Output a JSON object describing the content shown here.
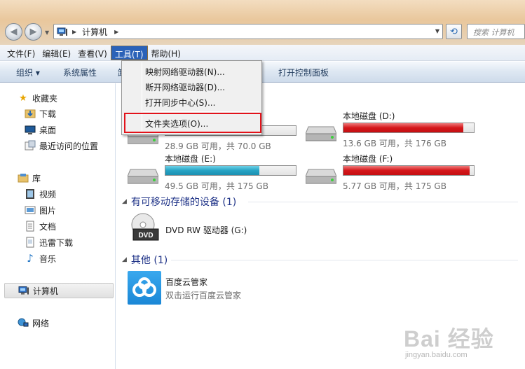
{
  "address": {
    "crumb": "计算机",
    "search_placeholder": "搜索 计算机"
  },
  "menu": {
    "items": [
      "文件(F)",
      "编辑(E)",
      "查看(V)",
      "工具(T)",
      "帮助(H)"
    ],
    "active": "工具(T)"
  },
  "toolbar": {
    "organize": "组织 ▾",
    "system_properties": "系统属性",
    "partial": "卸",
    "open_control_panel": "打开控制面板"
  },
  "tools_menu": {
    "items": [
      "映射网络驱动器(N)...",
      "断开网络驱动器(D)...",
      "打开同步中心(S)...",
      "文件夹选项(O)..."
    ],
    "highlighted": "文件夹选项(O)..."
  },
  "sidebar": {
    "favorites": "收藏夹",
    "fav_items": [
      "下载",
      "桌面",
      "最近访问的位置"
    ],
    "libraries": "库",
    "lib_items": [
      "视频",
      "图片",
      "文档",
      "迅雷下载",
      "音乐"
    ],
    "computer": "计算机",
    "network": "网络"
  },
  "drives": [
    {
      "name": "",
      "free": "28.9 GB 可用，共 70.0 GB",
      "used_fraction": 0.59,
      "color": "#27a3c4"
    },
    {
      "name": "本地磁盘 (D:)",
      "free": "13.6 GB 可用，共 176 GB",
      "used_fraction": 0.92,
      "color": "#d4161a"
    },
    {
      "name": "本地磁盘 (E:)",
      "free": "49.5 GB 可用，共 175 GB",
      "used_fraction": 0.72,
      "color": "#27a3c4"
    },
    {
      "name": "本地磁盘 (F:)",
      "free": "5.77 GB 可用，共 175 GB",
      "used_fraction": 0.97,
      "color": "#d4161a"
    }
  ],
  "removable": {
    "header": "有可移动存储的设备 (1)",
    "dvd_name": "DVD RW 驱动器 (G:)",
    "dvd_label": "DVD"
  },
  "other": {
    "header": "其他 (1)",
    "app_name": "百度云管家",
    "app_desc": "双击运行百度云管家"
  },
  "watermark": {
    "text": "Bai 经验",
    "url": "jingyan.baidu.com"
  },
  "colors": {
    "menu_active": "#2b62b8",
    "highlight_box": "#e3121a",
    "group_header": "#1e3287"
  }
}
